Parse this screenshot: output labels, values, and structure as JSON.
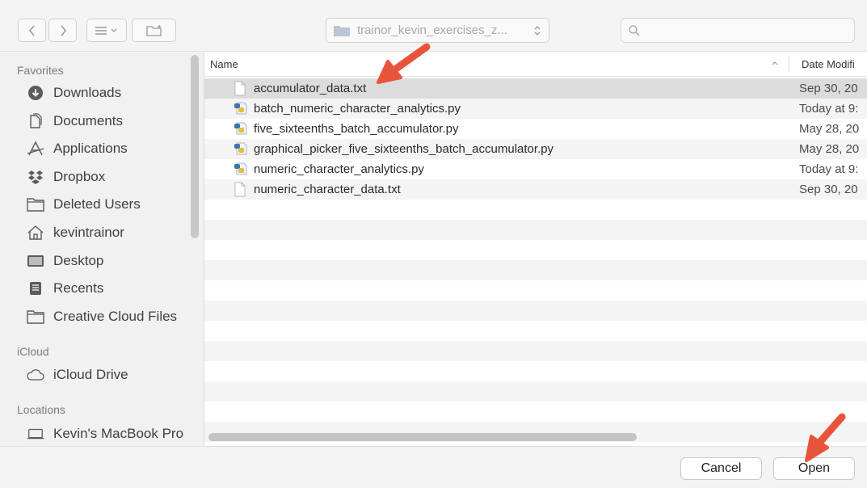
{
  "toolbar": {
    "path_label": "trainor_kevin_exercises_z...",
    "search_placeholder": ""
  },
  "sidebar": {
    "sections": [
      {
        "label": "Favorites"
      },
      {
        "label": "iCloud"
      },
      {
        "label": "Locations"
      }
    ],
    "items": [
      {
        "label": "Downloads",
        "icon": "downloads-icon"
      },
      {
        "label": "Documents",
        "icon": "documents-icon"
      },
      {
        "label": "Applications",
        "icon": "applications-icon"
      },
      {
        "label": "Dropbox",
        "icon": "dropbox-icon"
      },
      {
        "label": "Deleted Users",
        "icon": "folder-icon"
      },
      {
        "label": "kevintrainor",
        "icon": "home-icon"
      },
      {
        "label": "Desktop",
        "icon": "desktop-icon"
      },
      {
        "label": "Recents",
        "icon": "recents-icon"
      },
      {
        "label": "Creative Cloud Files",
        "icon": "folder-icon"
      },
      {
        "label": "iCloud Drive",
        "icon": "cloud-icon"
      },
      {
        "label": "Kevin's MacBook Pro",
        "icon": "laptop-icon"
      }
    ]
  },
  "list": {
    "headers": {
      "name": "Name",
      "date": "Date Modifi"
    },
    "files": [
      {
        "name": "accumulator_data.txt",
        "date": "Sep 30, 20",
        "type": "text",
        "selected": true
      },
      {
        "name": "batch_numeric_character_analytics.py",
        "date": "Today at 9:",
        "type": "python"
      },
      {
        "name": "five_sixteenths_batch_accumulator.py",
        "date": "May 28, 20",
        "type": "python"
      },
      {
        "name": "graphical_picker_five_sixteenths_batch_accumulator.py",
        "date": "May 28, 20",
        "type": "python"
      },
      {
        "name": "numeric_character_analytics.py",
        "date": "Today at 9:",
        "type": "python"
      },
      {
        "name": "numeric_character_data.txt",
        "date": "Sep 30, 20",
        "type": "text"
      }
    ]
  },
  "buttons": {
    "cancel": "Cancel",
    "open": "Open"
  },
  "colors": {
    "selection": "#dcdcdc",
    "arrow": "#e8543a",
    "stripe": "#f4f4f4"
  }
}
